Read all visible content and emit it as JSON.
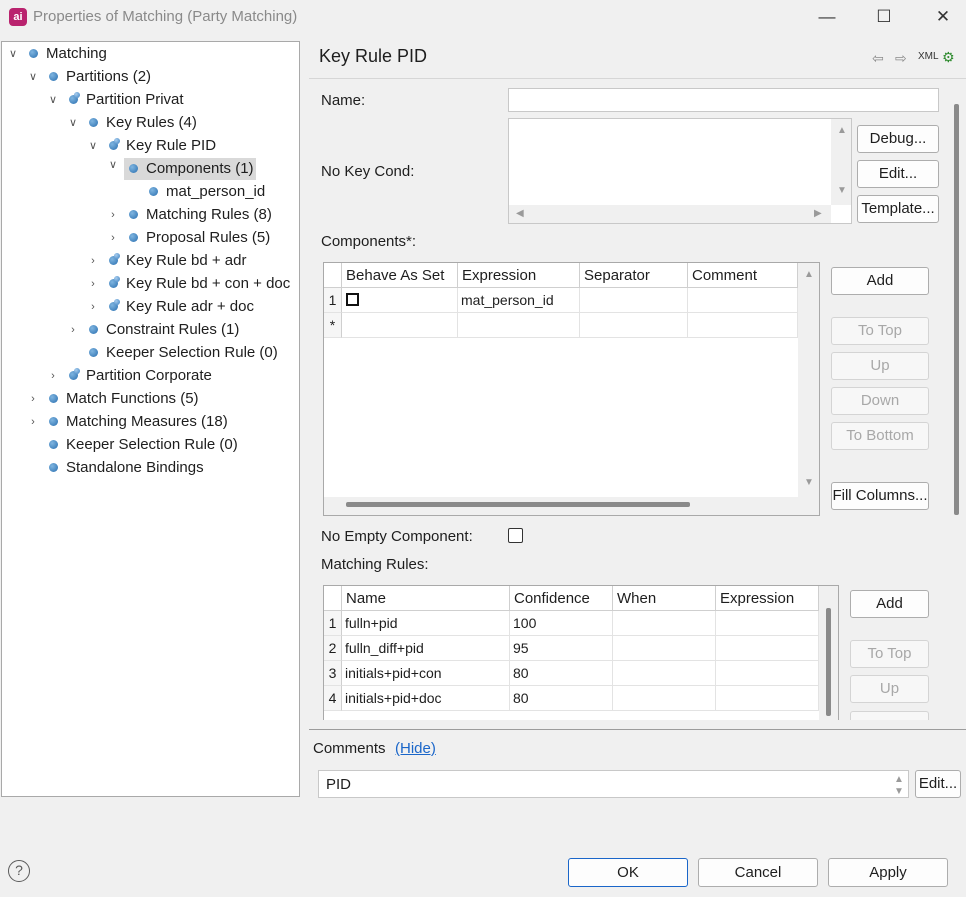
{
  "window": {
    "title": "Properties of Matching (Party Matching)",
    "app_icon": "ai"
  },
  "tree": {
    "items": [
      {
        "label": "Matching"
      },
      {
        "label": "Partitions (2)"
      },
      {
        "label": "Partition Privat"
      },
      {
        "label": "Key Rules (4)"
      },
      {
        "label": "Key Rule PID"
      },
      {
        "label": "Components (1)"
      },
      {
        "label": "mat_person_id"
      },
      {
        "label": "Matching Rules (8)"
      },
      {
        "label": "Proposal Rules (5)"
      },
      {
        "label": "Key Rule bd + adr"
      },
      {
        "label": "Key Rule bd + con + doc"
      },
      {
        "label": "Key Rule adr + doc"
      },
      {
        "label": "Constraint Rules (1)"
      },
      {
        "label": "Keeper Selection Rule (0)"
      },
      {
        "label": "Partition Corporate"
      },
      {
        "label": "Match Functions (5)"
      },
      {
        "label": "Matching Measures (18)"
      },
      {
        "label": "Keeper Selection Rule (0)"
      },
      {
        "label": "Standalone Bindings"
      }
    ]
  },
  "panel": {
    "title": "Key Rule PID",
    "xml_label": "XML",
    "name_label": "Name:",
    "name_value": "",
    "no_key_cond_label": "No Key Cond:",
    "debug_button": "Debug...",
    "edit_button": "Edit...",
    "template_button": "Template...",
    "components_label": "Components*:",
    "components_columns": [
      "Behave As Set",
      "Expression",
      "Separator",
      "Comment"
    ],
    "components_rows": [
      {
        "num": "1",
        "expression": "mat_person_id",
        "separator": "",
        "comment": ""
      }
    ],
    "new_row_marker": "*",
    "add_button": "Add",
    "to_top_button": "To Top",
    "up_button": "Up",
    "down_button": "Down",
    "to_bottom_button": "To Bottom",
    "fill_columns_button": "Fill Columns...",
    "no_empty_component_label": "No Empty Component:",
    "matching_rules_label": "Matching Rules:",
    "matching_columns": [
      "Name",
      "Confidence",
      "When",
      "Expression"
    ],
    "matching_rows": [
      {
        "num": "1",
        "name": "fulln+pid",
        "confidence": "100"
      },
      {
        "num": "2",
        "name": "fulln_diff+pid",
        "confidence": "95"
      },
      {
        "num": "3",
        "name": "initials+pid+con",
        "confidence": "80"
      },
      {
        "num": "4",
        "name": "initials+pid+doc",
        "confidence": "80"
      }
    ],
    "matching_add_button": "Add",
    "matching_to_top_button": "To Top",
    "matching_up_button": "Up"
  },
  "comments": {
    "label": "Comments",
    "hide_link": "(Hide)",
    "value": "PID",
    "edit_button": "Edit..."
  },
  "footer": {
    "ok": "OK",
    "cancel": "Cancel",
    "apply": "Apply",
    "help_icon": "?"
  }
}
